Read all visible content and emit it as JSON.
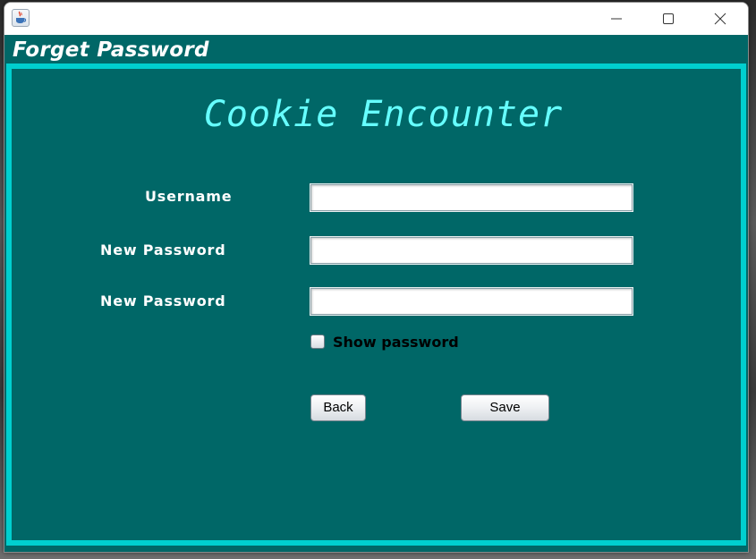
{
  "window": {
    "title_icon": "java-cup-icon",
    "controls": [
      "minimize-icon",
      "maximize-icon",
      "close-icon"
    ]
  },
  "header": {
    "title": "Forget Password"
  },
  "main": {
    "app_title": "Cookie Encounter",
    "fields": [
      {
        "label": "Username",
        "value": ""
      },
      {
        "label": "New Password",
        "value": ""
      },
      {
        "label": "New Password",
        "value": ""
      }
    ],
    "show_password": {
      "label": "Show password",
      "checked": false
    },
    "buttons": {
      "back": "Back",
      "save": "Save"
    }
  },
  "colors": {
    "background": "#006767",
    "frame_border": "#00cfcf",
    "app_title": "#66ffff",
    "label_text": "#ffffff"
  }
}
